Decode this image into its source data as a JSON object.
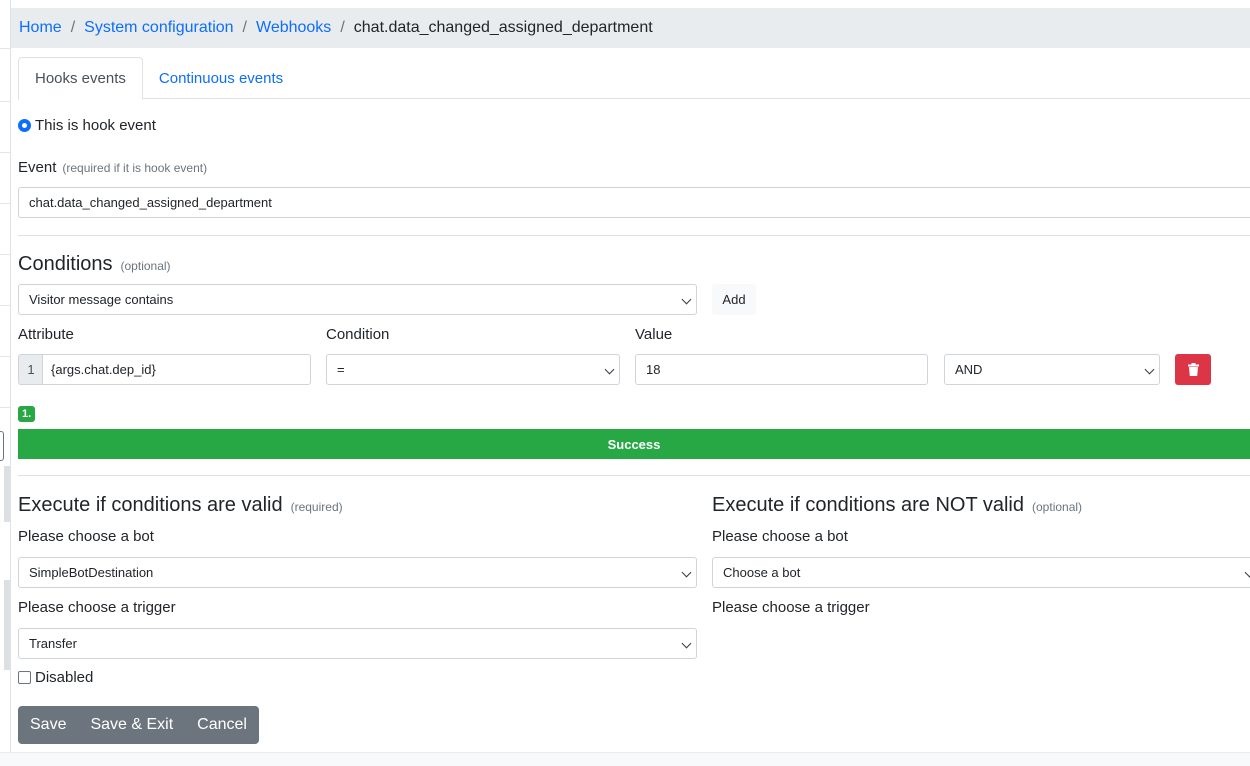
{
  "breadcrumb": {
    "items": [
      "Home",
      "System configuration",
      "Webhooks"
    ],
    "current": "chat.data_changed_assigned_department"
  },
  "tabs": [
    "Hooks events",
    "Continuous events"
  ],
  "hook_radio_label": "This is hook event",
  "event": {
    "label": "Event",
    "note": "(required if it is hook event)",
    "value": "chat.data_changed_assigned_department"
  },
  "conditions": {
    "title": "Conditions",
    "note": "(optional)",
    "type_select": "Visitor message contains",
    "add_label": "Add",
    "headers": {
      "attribute": "Attribute",
      "condition": "Condition",
      "value": "Value"
    },
    "rows": [
      {
        "index": "1",
        "attribute": "{args.chat.dep_id}",
        "condition": "=",
        "value": "18",
        "logic": "AND"
      }
    ],
    "badge": "1.",
    "result": "Success"
  },
  "execute_valid": {
    "title": "Execute if conditions are valid",
    "note": "(required)",
    "bot_label": "Please choose a bot",
    "bot_value": "SimpleBotDestination",
    "trigger_label": "Please choose a trigger",
    "trigger_value": "Transfer"
  },
  "execute_invalid": {
    "title": "Execute if conditions are NOT valid",
    "note": "(optional)",
    "bot_label": "Please choose a bot",
    "bot_value": "Choose a bot",
    "trigger_label": "Please choose a trigger"
  },
  "disabled_label": "Disabled",
  "actions": {
    "save": "Save",
    "save_exit": "Save & Exit",
    "cancel": "Cancel"
  },
  "colors": {
    "primary": "#0d6efd",
    "success": "#28a745",
    "danger": "#dc3545",
    "secondary": "#6c757d"
  }
}
